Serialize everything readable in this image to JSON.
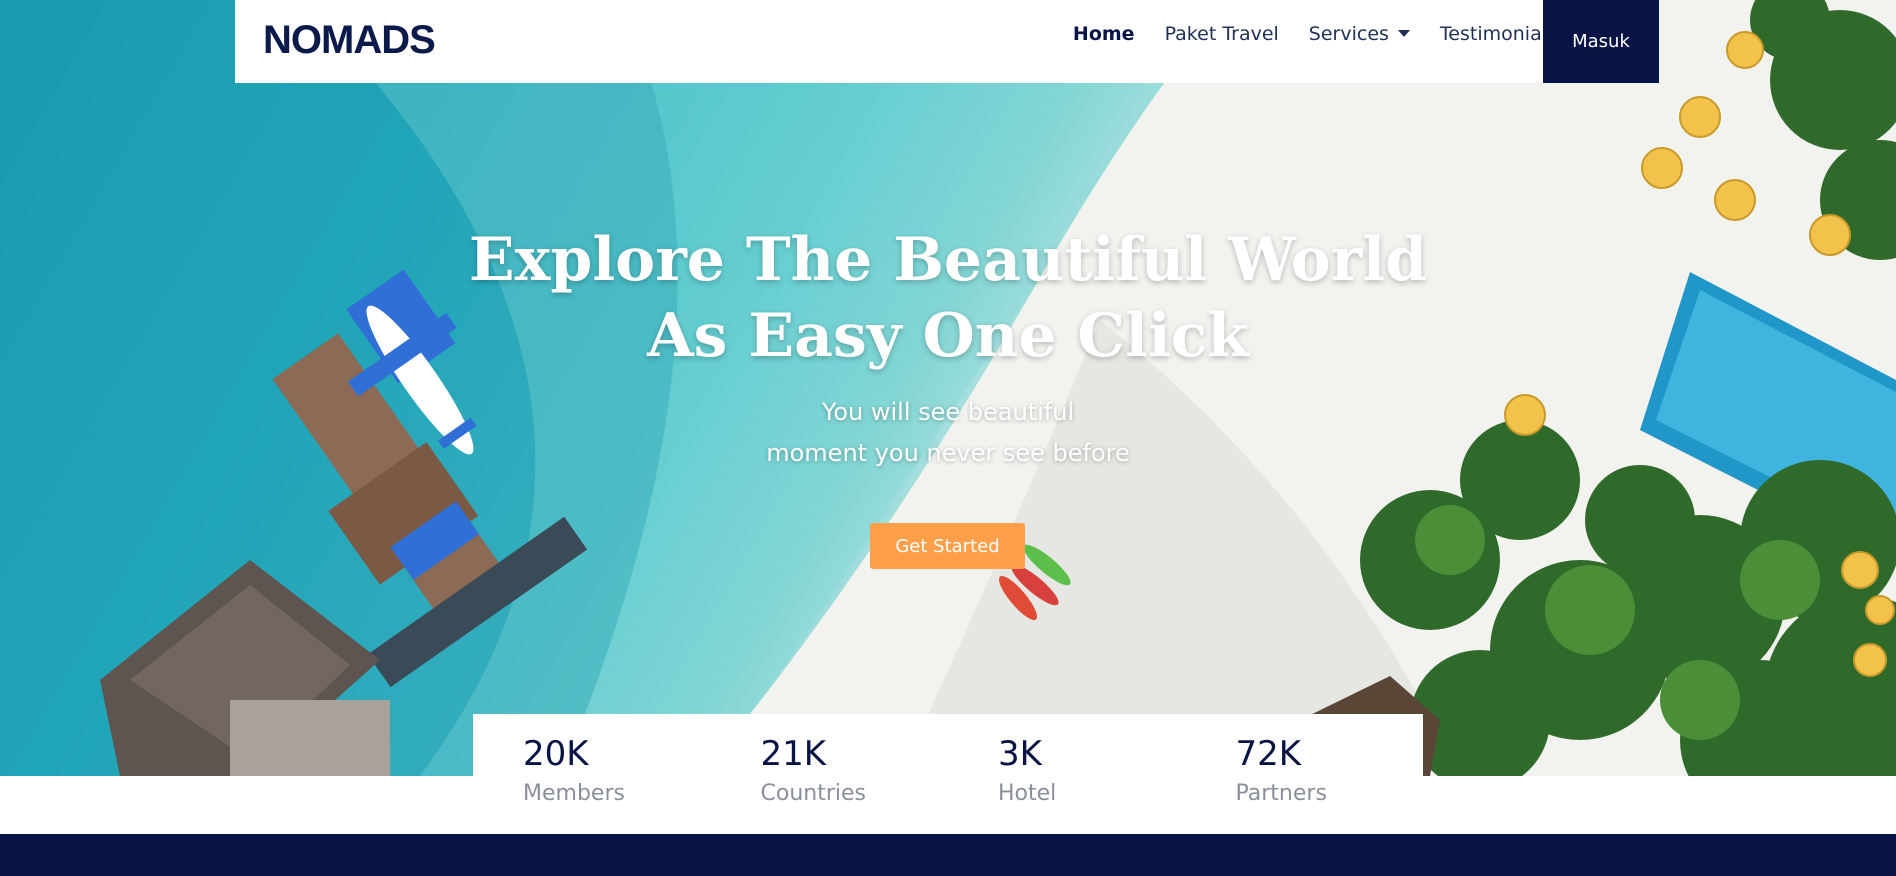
{
  "brand": {
    "logo_text": "NOMADS",
    "color": "#0b1a4a"
  },
  "nav": {
    "items": [
      {
        "label": "Home",
        "active": true
      },
      {
        "label": "Paket Travel"
      },
      {
        "label": "Services",
        "has_dropdown": true
      },
      {
        "label": "Testimonial"
      }
    ],
    "login_label": "Masuk"
  },
  "hero": {
    "title": "Explore The Beautiful World\nAs Easy One Click",
    "subtitle": "You will see beautiful\nmoment you never see before",
    "cta_label": "Get Started"
  },
  "stats": [
    {
      "value": "20K",
      "label": "Members"
    },
    {
      "value": "21K",
      "label": "Countries"
    },
    {
      "value": "3K",
      "label": "Hotel"
    },
    {
      "value": "72K",
      "label": "Partners"
    }
  ],
  "colors": {
    "primary": "#071445",
    "accent": "#ff9f4a",
    "muted": "#8a8f9c"
  }
}
